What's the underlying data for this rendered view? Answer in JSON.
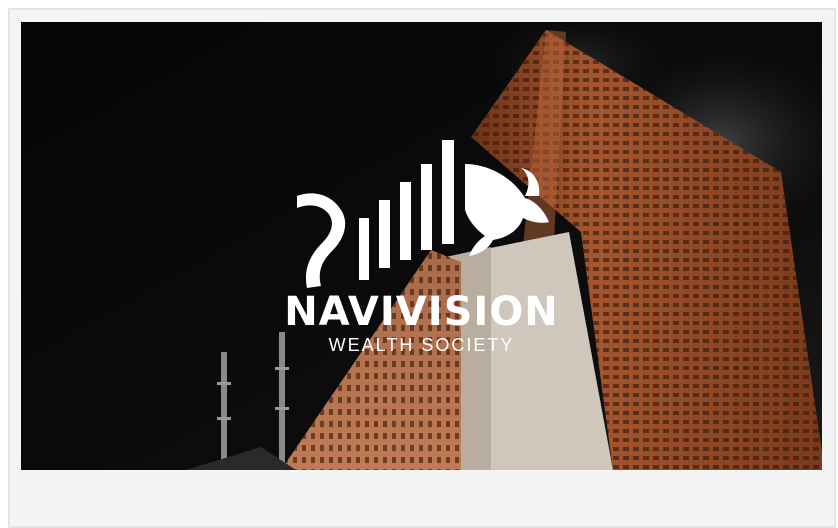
{
  "hero": {
    "brand_name": "NAVIVISION",
    "brand_tagline": "WEALTH SOCIETY",
    "logo_icon": "bull-with-bar-chart-icon",
    "background": "night-skyscraper-photo"
  },
  "colors": {
    "sky": "#0a0a0a",
    "building_brick": "#a0552e",
    "building_light": "#d8d0c6",
    "logo": "#ffffff",
    "frame_bg": "#f4f4f4",
    "frame_border": "#e4e4e4"
  }
}
